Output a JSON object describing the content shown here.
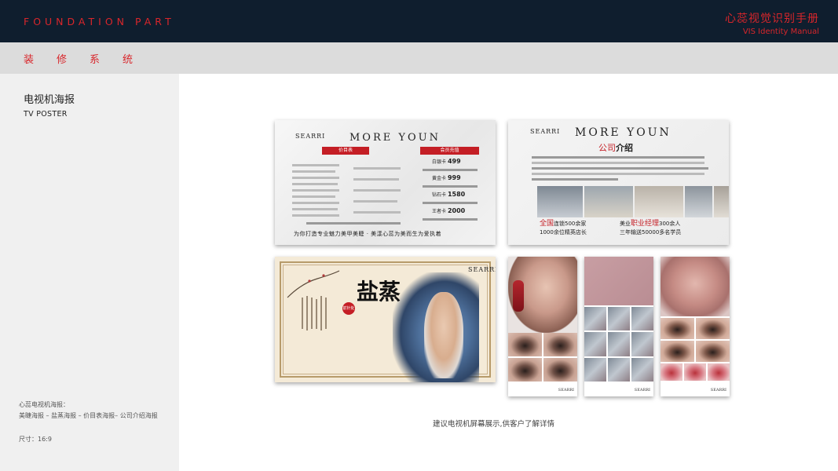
{
  "header": {
    "brand_en": "FOUNDATION PART",
    "manual_cn": "心蕊视觉识别手册",
    "manual_en": "VIS Identity Manual"
  },
  "section": {
    "title": "装修系统"
  },
  "sidebar": {
    "title_cn": "电视机海报",
    "title_en": "TV POSTER",
    "note_title": "心蕊电视机海报：",
    "note_items": "美睫海报 – 盐蒸海报 – 价目表海报– 公司介绍海报",
    "size": "尺寸：16:9"
  },
  "posters": {
    "logo": "SEARRI",
    "more_youn": "MORE YOUN",
    "price": {
      "ribbon_left": "价目表",
      "ribbon_right": "会员充值",
      "members": [
        {
          "label": "白银卡",
          "value": "499"
        },
        {
          "label": "黄金卡",
          "value": "999"
        },
        {
          "label": "钻石卡",
          "value": "1580"
        },
        {
          "label": "王者卡",
          "value": "2000"
        }
      ],
      "slogan": "为你打造专业魅力美甲美睫 · 美漾心蕊为美而生为爱执着"
    },
    "company": {
      "title_red": "公司",
      "title_rest": "介绍",
      "stat1a": "全国",
      "stat1b": "连锁500余家",
      "stat2": "1000余位精英店长",
      "stat3a": "美业",
      "stat3b": "职业经理",
      "stat3c": "300余人",
      "stat4": "三年输送50000多名学员"
    },
    "saltsteam": {
      "calligraphy": "盐蒸",
      "seal": "前针处"
    }
  },
  "caption": "建议电视机屏幕展示,供客户了解详情",
  "colors": {
    "brand_red": "#d8262b",
    "navy": "#0f1e2e"
  }
}
